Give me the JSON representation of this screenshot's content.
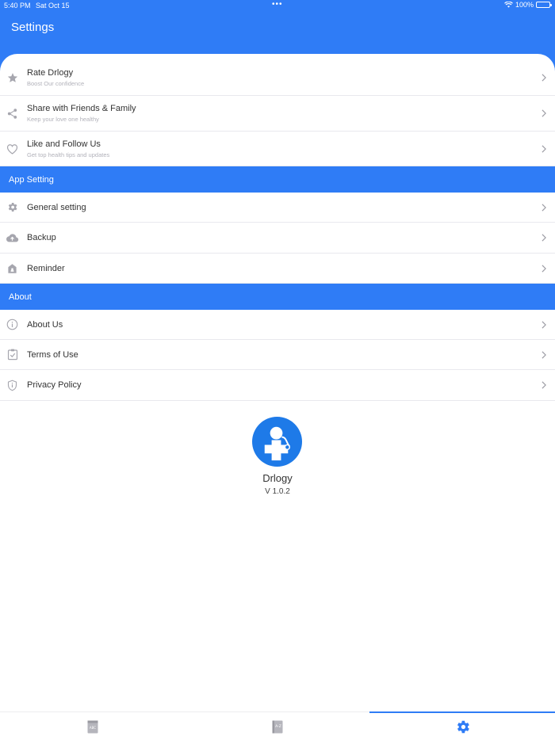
{
  "status_bar": {
    "time": "5:40 PM",
    "date": "Sat Oct 15",
    "dots": "•••",
    "battery_percent": "100%",
    "battery_level": 1.0
  },
  "header": {
    "title": "Settings"
  },
  "colors": {
    "accent": "#2f7cf6",
    "icon_gray": "#a6a6ae",
    "divider": "#e9e9ee"
  },
  "share_section": {
    "items": [
      {
        "title": "Rate Drlogy",
        "subtitle": "Boost Our confidence",
        "icon": "star-icon"
      },
      {
        "title": "Share with Friends & Family",
        "subtitle": "Keep your love one healthy",
        "icon": "share-icon"
      },
      {
        "title": "Like and Follow Us",
        "subtitle": "Get top health tips and updates",
        "icon": "heart-icon"
      }
    ]
  },
  "app_setting_section": {
    "header": "App Setting",
    "items": [
      {
        "title": "General setting",
        "icon": "gear-icon"
      },
      {
        "title": "Backup",
        "icon": "cloud-upload-icon"
      },
      {
        "title": "Reminder",
        "icon": "reminder-icon"
      }
    ]
  },
  "about_section": {
    "header": "About",
    "items": [
      {
        "title": "About Us",
        "icon": "info-icon"
      },
      {
        "title": "Terms of Use",
        "icon": "checklist-icon"
      },
      {
        "title": "Privacy Policy",
        "icon": "shield-icon"
      }
    ]
  },
  "brand": {
    "name": "Drlogy",
    "version": "V 1.0.2"
  },
  "tabbar": {
    "tabs": [
      {
        "icon": "abc-book-icon",
        "active": false
      },
      {
        "icon": "az-book-icon",
        "active": false
      },
      {
        "icon": "gear-icon",
        "active": true
      }
    ]
  }
}
